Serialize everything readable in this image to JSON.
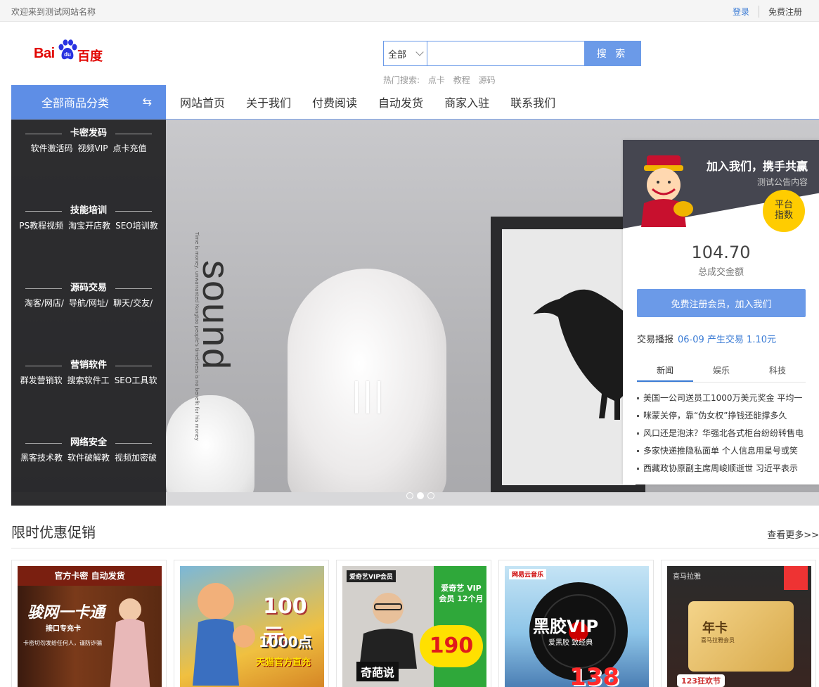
{
  "topbar": {
    "welcome": "欢迎来到测试网站名称",
    "login": "登录",
    "register": "免费注册"
  },
  "logo": {
    "left": "Bai",
    "mark": "du",
    "right": "百度"
  },
  "search": {
    "scope": "全部",
    "placeholder": "",
    "button": "搜 索",
    "hot_label": "热门搜索:",
    "hot": [
      "点卡",
      "教程",
      "源码"
    ]
  },
  "nav": {
    "category_label": "全部商品分类",
    "items": [
      "网站首页",
      "关于我们",
      "付费阅读",
      "自动发货",
      "商家入驻",
      "联系我们"
    ]
  },
  "categories": [
    {
      "title": "卡密发码",
      "items": [
        "软件激活码",
        "视频VIP",
        "点卡充值"
      ]
    },
    {
      "title": "技能培训",
      "items": [
        "PS教程视频",
        "淘宝开店教",
        "SEO培训教"
      ]
    },
    {
      "title": "源码交易",
      "items": [
        "淘客/网店/",
        "导航/网址/",
        "聊天/交友/"
      ]
    },
    {
      "title": "营销软件",
      "items": [
        "群发营销软",
        "搜索软件工",
        "SEO工具软"
      ]
    },
    {
      "title": "网络安全",
      "items": [
        "黑客技术教",
        "软件破解教",
        "视频加密破"
      ]
    }
  ],
  "banner": {
    "word": "sound",
    "tagline": "Time is money, unwarranted Kongtao people's timeliness is no benefit for his money",
    "slides": 3,
    "active_slide": 1
  },
  "panel": {
    "title": "加入我们，携手共赢",
    "subtitle": "测试公告内容",
    "badge": "平台\n指数",
    "badge_line1": "平台",
    "badge_line2": "指数",
    "amount": "104.70",
    "amount_label": "总成交金额",
    "join_button": "免费注册会员，加入我们",
    "deal_label": "交易播报",
    "deal_value": "06-09 产生交易 1.10元",
    "tabs": [
      "新闻",
      "娱乐",
      "科技"
    ],
    "news": [
      "美国一公司送员工1000万美元奖金 平均一",
      "咪蒙关停，靠“伪女权”挣钱还能撑多久",
      "风口还是泡沫？华强北各式柜台纷纷转售电",
      "多家快递推隐私面单 个人信息用星号或笑",
      "西藏政协原副主席周峻顺逝世 习近平表示"
    ]
  },
  "promo": {
    "title": "限时优惠促销",
    "more": "查看更多>>",
    "cards": [
      {
        "top": "官方卡密  自动发货",
        "main": "骏网一卡通",
        "sub": "接口专充卡",
        "note": "卡密切勿发给任何人，谨防诈骗"
      },
      {
        "top": "",
        "main": "100元",
        "sub": "1000点",
        "note": "天猫官方直充"
      },
      {
        "top": "爱奇艺VIP会员",
        "main": "190",
        "sub": "爱奇艺 VIP会员 12个月",
        "note": "奇葩说"
      },
      {
        "top": "网易云音乐",
        "main": "黑胶VIP",
        "sub": "爱黑胶 致经典",
        "note": "138"
      },
      {
        "top": "喜马拉雅",
        "main": "年卡",
        "sub": "喜马拉雅会员",
        "note": "123狂欢节"
      }
    ]
  },
  "colors": {
    "accent": "#5e8ee6",
    "link": "#3a7bd5",
    "badge": "#ffcc00",
    "sidebar": "#202022"
  }
}
